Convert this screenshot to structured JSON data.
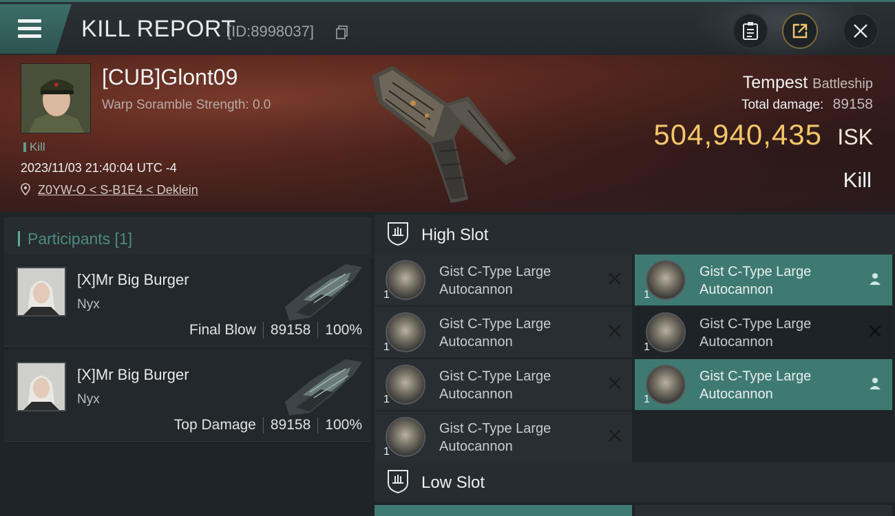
{
  "header": {
    "title": "KILL REPORT",
    "report_id": "[ID:8998037]"
  },
  "victim": {
    "pilot_name": "[CUB]Glont09",
    "scramble_text": "Warp Soramble Strength: 0.0",
    "type_tag": "Kill",
    "datetime": "2023/11/03 21:40:04 UTC -4",
    "location": "Z0YW-O < S-B1E4 < Deklein",
    "ship_name": "Tempest",
    "ship_class": "Battleship",
    "total_damage_label": "Total damage:",
    "total_damage": "89158",
    "isk_value": "504,940,435",
    "isk_unit": "ISK",
    "result": "Kill"
  },
  "participants": {
    "title": "Participants [1]",
    "items": [
      {
        "name": "[X]Mr Big Burger",
        "ship": "Nyx",
        "role": "Final Blow",
        "damage": "89158",
        "percent": "100%"
      },
      {
        "name": "[X]Mr Big Burger",
        "ship": "Nyx",
        "role": "Top Damage",
        "damage": "89158",
        "percent": "100%"
      }
    ]
  },
  "slots": {
    "high_label": "High Slot",
    "low_label": "Low Slot",
    "high_modules": [
      {
        "line1": "Gist C-Type Large",
        "line2": "Autocannon",
        "qty": "1",
        "status": "destroyed-icon"
      },
      {
        "line1": "Gist C-Type Large",
        "line2": "Autocannon",
        "qty": "1",
        "status": "dropped-icon"
      },
      {
        "line1": "Gist C-Type Large",
        "line2": "Autocannon",
        "qty": "1",
        "status": "destroyed-icon"
      },
      {
        "line1": "Gist C-Type Large",
        "line2": "Autocannon",
        "qty": "1",
        "status": "destroyed-icon"
      },
      {
        "line1": "Gist C-Type Large",
        "line2": "Autocannon",
        "qty": "1",
        "status": "destroyed-icon"
      },
      {
        "line1": "Gist C-Type Large",
        "line2": "Autocannon",
        "qty": "1",
        "status": "dropped-icon"
      },
      {
        "line1": "Gist C-Type Large",
        "line2": "Autocannon",
        "qty": "1",
        "status": "destroyed-icon"
      }
    ]
  },
  "colors": {
    "accent": "#3f7a72",
    "isk": "#f3c66a"
  }
}
